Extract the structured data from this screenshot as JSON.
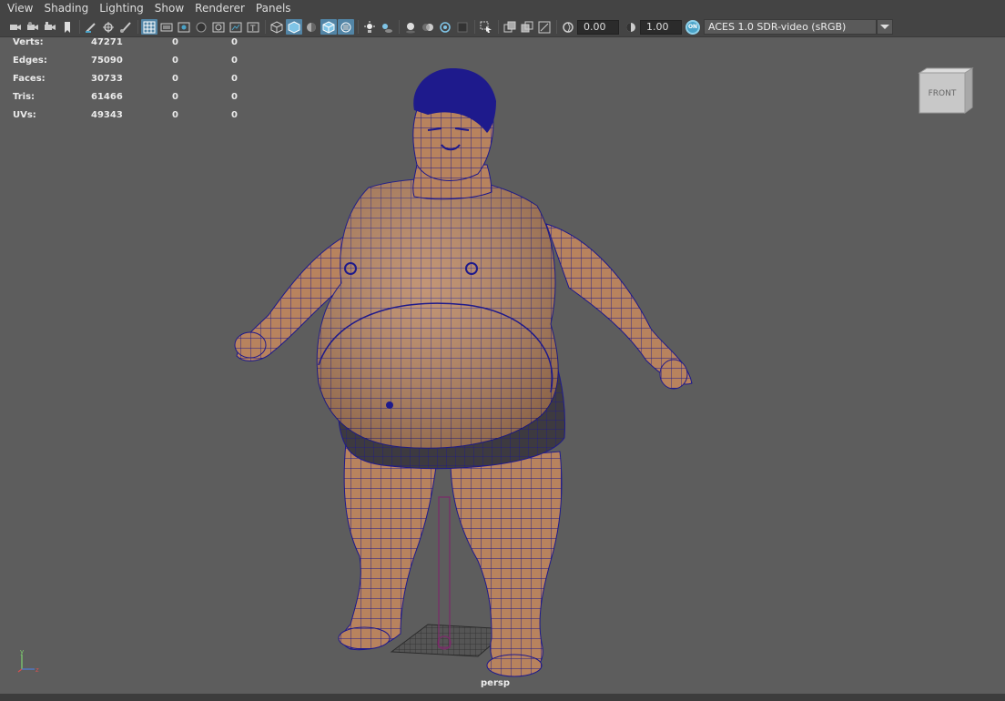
{
  "menu": [
    "View",
    "Shading",
    "Lighting",
    "Show",
    "Renderer",
    "Panels"
  ],
  "toolbar": {
    "exposure_value": "0.00",
    "gamma_value": "1.00",
    "color_management_badge": "ON",
    "color_space": "ACES 1.0 SDR-video (sRGB)"
  },
  "hud": {
    "rows": [
      {
        "label": "Verts:",
        "v1": "47271",
        "v2": "0",
        "v3": "0"
      },
      {
        "label": "Edges:",
        "v1": "75090",
        "v2": "0",
        "v3": "0"
      },
      {
        "label": "Faces:",
        "v1": "30733",
        "v2": "0",
        "v3": "0"
      },
      {
        "label": "Tris:",
        "v1": "61466",
        "v2": "0",
        "v3": "0"
      },
      {
        "label": "UVs:",
        "v1": "49343",
        "v2": "0",
        "v3": "0"
      }
    ]
  },
  "viewcube": {
    "face_label": "FRONT"
  },
  "camera_label": "persp",
  "axis": {
    "y": "y",
    "z": "z"
  },
  "colors": {
    "viewport_bg": "#5d5d5d",
    "ui_bg": "#444444",
    "active_icon": "#5285a6",
    "wireframe": "#1e1a8c",
    "skin": "#b8835e"
  }
}
